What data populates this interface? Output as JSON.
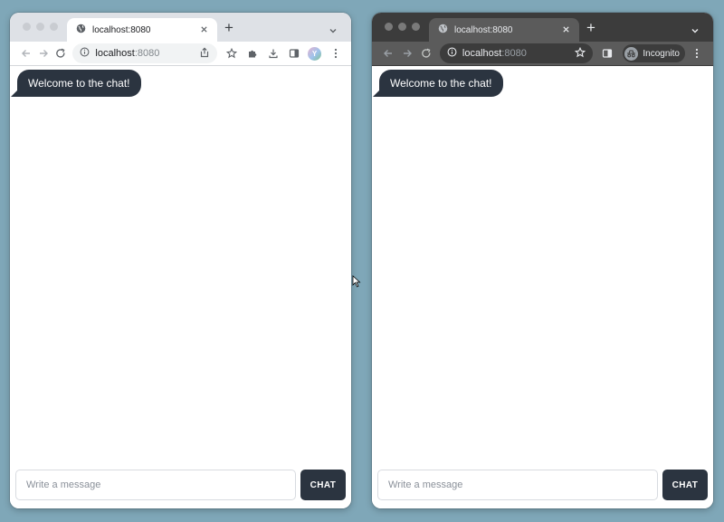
{
  "colors": {
    "desktop_background": "#7fa7b8",
    "bubble_bg": "#2b3440",
    "send_button_bg": "#2b3440"
  },
  "left_window": {
    "mode": "regular",
    "tab": {
      "title": "localhost:8080",
      "favicon": "globe-icon",
      "close_icon": "close-icon"
    },
    "new_tab_label": "+",
    "address_bar": {
      "host": "localhost",
      "port": ":8080",
      "site_info_icon": "info-icon"
    },
    "toolbar_icons": [
      "share-icon",
      "star-icon",
      "extensions-icon",
      "download-icon",
      "side-panel-icon",
      "profile-avatar",
      "more-icon"
    ],
    "profile_initial": "Y",
    "chat": {
      "messages": [
        {
          "text": "Welcome to the chat!"
        }
      ],
      "input_placeholder": "Write a message",
      "send_label": "CHAT"
    }
  },
  "right_window": {
    "mode": "incognito",
    "tab": {
      "title": "localhost:8080",
      "favicon": "globe-icon",
      "close_icon": "close-icon"
    },
    "new_tab_label": "+",
    "address_bar": {
      "host": "localhost",
      "port": ":8080",
      "site_info_icon": "info-icon"
    },
    "toolbar_icons": [
      "star-icon",
      "side-panel-icon",
      "incognito-icon",
      "more-icon"
    ],
    "incognito_label": "Incognito",
    "chat": {
      "messages": [
        {
          "text": "Welcome to the chat!"
        }
      ],
      "input_placeholder": "Write a message",
      "send_label": "CHAT"
    }
  }
}
